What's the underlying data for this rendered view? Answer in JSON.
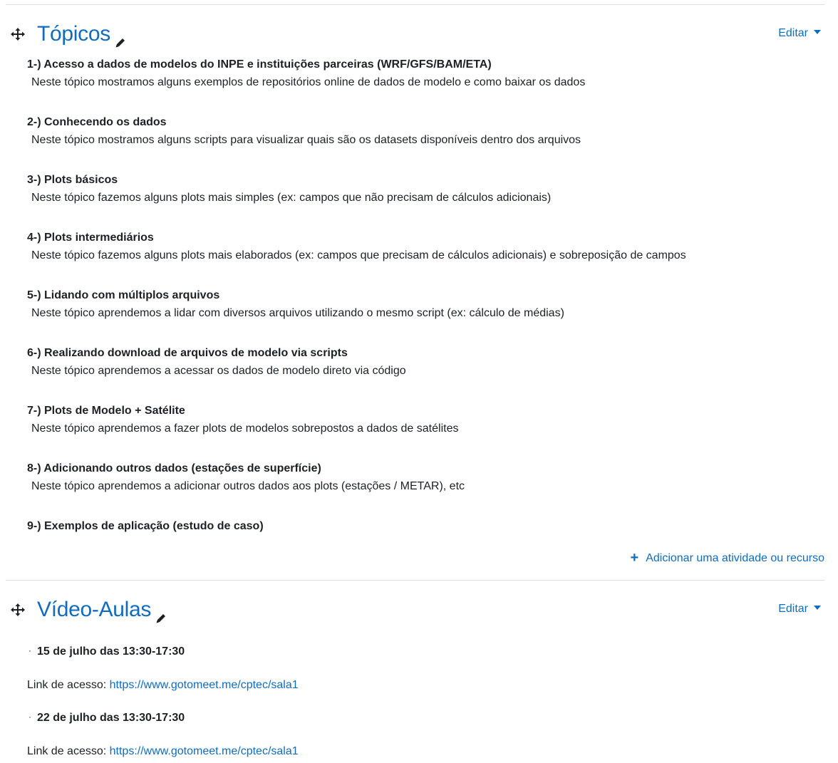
{
  "sections": [
    {
      "title": "Tópicos",
      "edit_label": "Editar",
      "topics": [
        {
          "title": "1-) Acesso a dados de modelos do INPE e instituições parceiras (WRF/GFS/BAM/ETA)",
          "description": "Neste tópico mostramos alguns exemplos de repositórios online de dados de modelo e como baixar os dados"
        },
        {
          "title": "2-) Conhecendo os dados",
          "description": "Neste tópico mostramos alguns scripts para visualizar quais são os datasets disponíveis dentro dos arquivos"
        },
        {
          "title": "3-) Plots básicos",
          "description": "Neste tópico fazemos alguns plots mais simples (ex: campos que não precisam de cálculos adicionais)"
        },
        {
          "title": "4-) Plots intermediários",
          "description": "Neste tópico fazemos alguns plots mais elaborados (ex: campos que precisam de cálculos adicionais) e sobreposição de campos"
        },
        {
          "title": "5-) Lidando com múltiplos arquivos",
          "description": "Neste tópico aprendemos a lidar com diversos arquivos utilizando o mesmo script (ex: cálculo de médias)"
        },
        {
          "title": "6-) Realizando download de arquivos de modelo via scripts",
          "description": "Neste tópico aprendemos a acessar os dados de modelo direto via código"
        },
        {
          "title": "7-) Plots de Modelo + Satélite",
          "description": "Neste tópico aprendemos a fazer plots de modelos sobrepostos a dados de satélites"
        },
        {
          "title": "8-) Adicionando outros dados (estações de superfície)",
          "description": "Neste tópico aprendemos a adicionar outros dados aos plots (estações / METAR), etc"
        },
        {
          "title": "9-) Exemplos de aplicação (estudo de caso)",
          "description": ""
        }
      ],
      "add_activity_label": "Adicionar uma atividade ou recurso"
    },
    {
      "title": "Vídeo-Aulas",
      "edit_label": "Editar",
      "sessions": [
        {
          "bullet": "·",
          "date": "15 de julho das 13:30-17:30",
          "link_prefix": "Link de acesso: ",
          "link": "https://www.gotomeet.me/cptec/sala1"
        },
        {
          "bullet": "·",
          "date": "22 de julho das 13:30-17:30",
          "link_prefix": "Link de acesso: ",
          "link": "https://www.gotomeet.me/cptec/sala1"
        }
      ]
    }
  ],
  "colors": {
    "link": "#0f6cbf",
    "text": "#1d2125",
    "divider": "#dee2e6"
  },
  "icons": {
    "move": "move-arrows-icon",
    "edit": "pencil-icon",
    "add": "plus-icon",
    "menu": "caret-down-icon"
  }
}
